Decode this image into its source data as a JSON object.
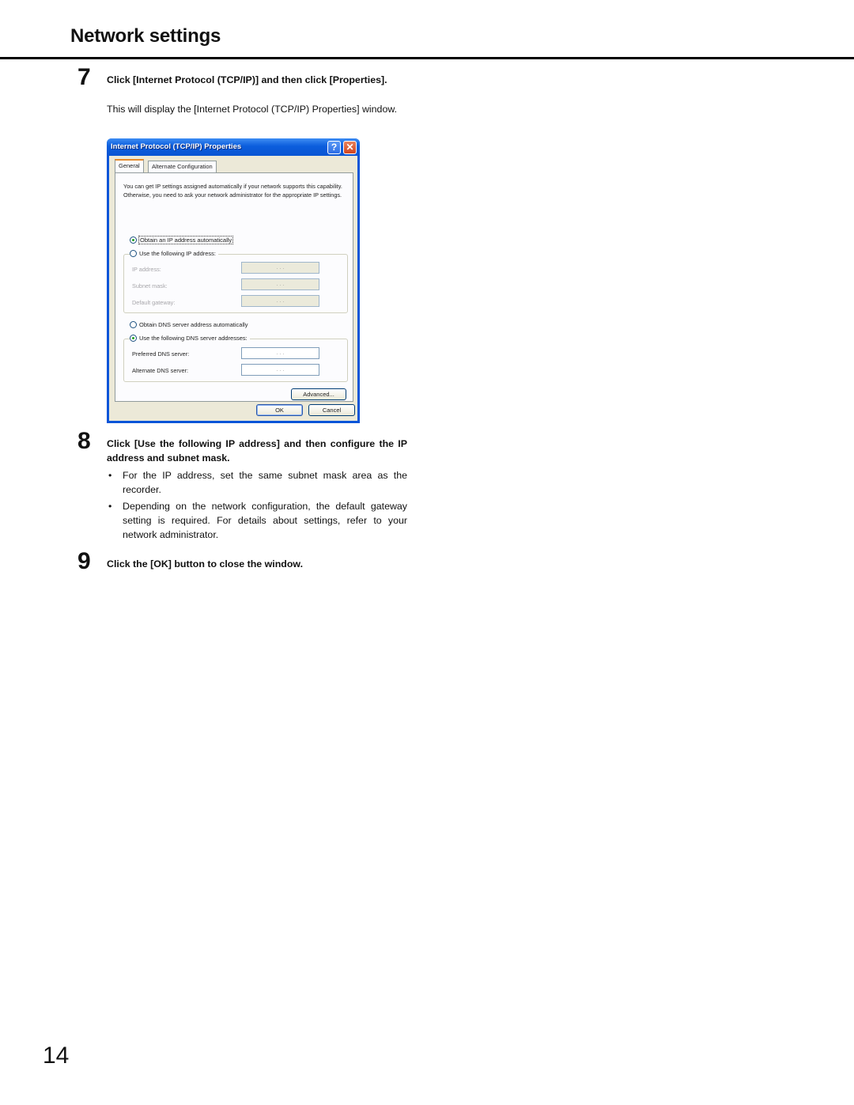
{
  "header": {
    "title": "Network settings"
  },
  "steps": [
    {
      "number": "7",
      "heading": "Click [Internet Protocol (TCP/IP)] and then click [Properties].",
      "body": "This will display the [Internet Protocol (TCP/IP) Properties] window."
    },
    {
      "number": "8",
      "heading": "Click [Use the following IP address] and then configure the IP address and subnet mask.",
      "bullets": [
        "For the IP address, set the same subnet mask area as the recorder.",
        "Depending on the network configuration, the default gateway setting is required. For details about settings, refer to your network administrator."
      ]
    },
    {
      "number": "9",
      "heading": "Click the [OK] button to close the window."
    }
  ],
  "bullet_glyph": "•",
  "dialog": {
    "title": "Internet Protocol (TCP/IP) Properties",
    "help_glyph": "?",
    "close_glyph": "✕",
    "tabs": [
      {
        "label": "General",
        "active": true
      },
      {
        "label": "Alternate Configuration",
        "active": false
      }
    ],
    "intro": "You can get IP settings assigned automatically if your network supports this capability. Otherwise, you need to ask your network administrator for the appropriate IP settings.",
    "ip_mode": {
      "auto_label": "Obtain an IP address automatically",
      "manual_label": "Use the following IP address:",
      "selected": "auto"
    },
    "ip_fields": [
      {
        "label": "IP address:",
        "value": ". . ."
      },
      {
        "label": "Subnet mask:",
        "value": ". . ."
      },
      {
        "label": "Default gateway:",
        "value": ". . ."
      }
    ],
    "dns_mode": {
      "auto_label": "Obtain DNS server address automatically",
      "manual_label": "Use the following DNS server addresses:",
      "selected": "manual"
    },
    "dns_fields": [
      {
        "label": "Preferred DNS server:",
        "value": ". . ."
      },
      {
        "label": "Alternate DNS server:",
        "value": ". . ."
      }
    ],
    "buttons": {
      "advanced": "Advanced...",
      "ok": "OK",
      "cancel": "Cancel"
    }
  },
  "footer": {
    "page_number": "14"
  }
}
